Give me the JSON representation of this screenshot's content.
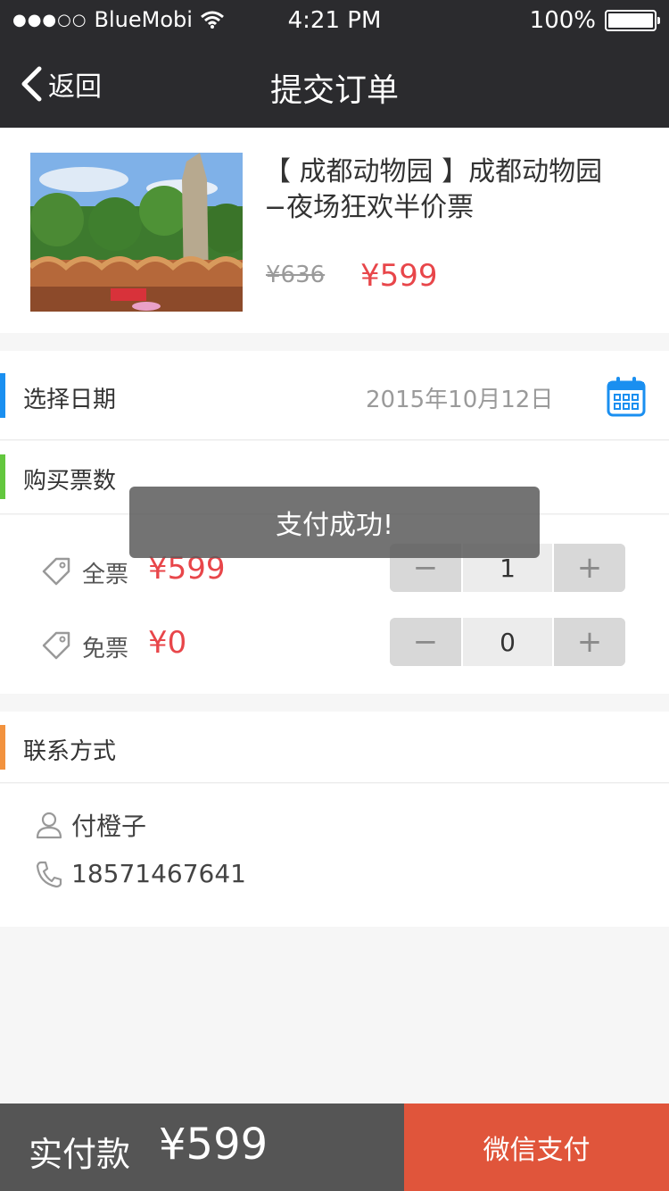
{
  "status_bar": {
    "carrier": "BlueMobi",
    "time": "4:21 PM",
    "battery": "100%"
  },
  "nav": {
    "back_label": "返回",
    "title": "提交订单"
  },
  "product": {
    "title": "【 成都动物园 】成都动物园 −夜场狂欢半价票",
    "original_price": "¥636",
    "price": "¥599"
  },
  "date_section": {
    "label": "选择日期",
    "value": "2015年10月12日"
  },
  "ticket_section": {
    "label": "购买票数",
    "items": [
      {
        "label": "全票",
        "price": "¥599",
        "minus": "−",
        "quantity": "1",
        "plus": "+"
      },
      {
        "label": "免票",
        "price": "¥0",
        "minus": "−",
        "quantity": "0",
        "plus": "+"
      }
    ]
  },
  "contact_section": {
    "label": "联系方式",
    "name": "付橙子",
    "phone": "18571467641"
  },
  "toast": {
    "message": "支付成功!"
  },
  "footer": {
    "pay_label": "实付款",
    "pay_amount": "¥599",
    "pay_button": "微信支付"
  },
  "colors": {
    "accent_red": "#e8464a",
    "nav_bg": "#2b2b2e",
    "pay_button": "#e0553b",
    "date_bar": "#1a8ff0",
    "ticket_bar": "#63c73e",
    "contact_bar": "#f2923e"
  }
}
